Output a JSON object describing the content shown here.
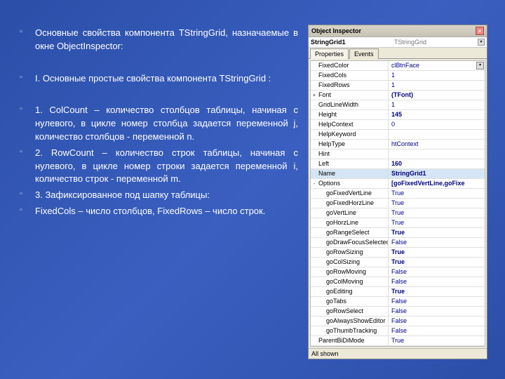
{
  "bullets": [
    "Основные свойства компонента TStringGrid, назначаемые в окне ObjectInspector:",
    "",
    "I. Основные простые свойства компонента TStringGrid :",
    "",
    "1. ColCount – количество столбцов таблицы, начиная с нулевого, в цикле номер столбца задается переменной j, количество столбцов - переменной n.",
    "2. RowCount – количество строк таблицы, начиная с нулевого, в цикле номер строки задается переменной i, количество строк - переменной m.",
    "3. Зафиксированное под шапку таблицы:",
    "FixedCols – число столбцов, FixedRows – число строк."
  ],
  "inspector": {
    "title": "Object Inspector",
    "component_name": "StringGrid1",
    "component_class": "TStringGrid",
    "tabs": [
      "Properties",
      "Events"
    ],
    "status": "All shown",
    "properties": [
      {
        "name": "FixedColor",
        "val": "clBtnFace",
        "dd": true
      },
      {
        "name": "FixedCols",
        "val": "1"
      },
      {
        "name": "FixedRows",
        "val": "1"
      },
      {
        "name": "Font",
        "val": "(TFont)",
        "exp": "+",
        "bold": true
      },
      {
        "name": "GridLineWidth",
        "val": "1"
      },
      {
        "name": "Height",
        "val": "145",
        "bold": true
      },
      {
        "name": "HelpContext",
        "val": "0"
      },
      {
        "name": "HelpKeyword",
        "val": ""
      },
      {
        "name": "HelpType",
        "val": "htContext"
      },
      {
        "name": "Hint",
        "val": ""
      },
      {
        "name": "Left",
        "val": "160",
        "bold": true
      },
      {
        "name": "Name",
        "val": "StringGrid1",
        "sel": true,
        "bold": true
      },
      {
        "name": "Options",
        "val": "[goFixedVertLine,goFixe",
        "exp": "-",
        "bold": true
      },
      {
        "name": "goFixedVertLine",
        "val": "True",
        "indent": true
      },
      {
        "name": "goFixedHorzLine",
        "val": "True",
        "indent": true
      },
      {
        "name": "goVertLine",
        "val": "True",
        "indent": true
      },
      {
        "name": "goHorzLine",
        "val": "True",
        "indent": true
      },
      {
        "name": "goRangeSelect",
        "val": "True",
        "indent": true,
        "bold": true
      },
      {
        "name": "goDrawFocusSelected",
        "val": "False",
        "indent": true
      },
      {
        "name": "goRowSizing",
        "val": "True",
        "indent": true,
        "bold": true
      },
      {
        "name": "goColSizing",
        "val": "True",
        "indent": true,
        "bold": true
      },
      {
        "name": "goRowMoving",
        "val": "False",
        "indent": true
      },
      {
        "name": "goColMoving",
        "val": "False",
        "indent": true
      },
      {
        "name": "goEditing",
        "val": "True",
        "indent": true,
        "bold": true
      },
      {
        "name": "goTabs",
        "val": "False",
        "indent": true
      },
      {
        "name": "goRowSelect",
        "val": "False",
        "indent": true
      },
      {
        "name": "goAlwaysShowEditor",
        "val": "False",
        "indent": true
      },
      {
        "name": "goThumbTracking",
        "val": "False",
        "indent": true
      },
      {
        "name": "ParentBiDiMode",
        "val": "True"
      }
    ]
  }
}
